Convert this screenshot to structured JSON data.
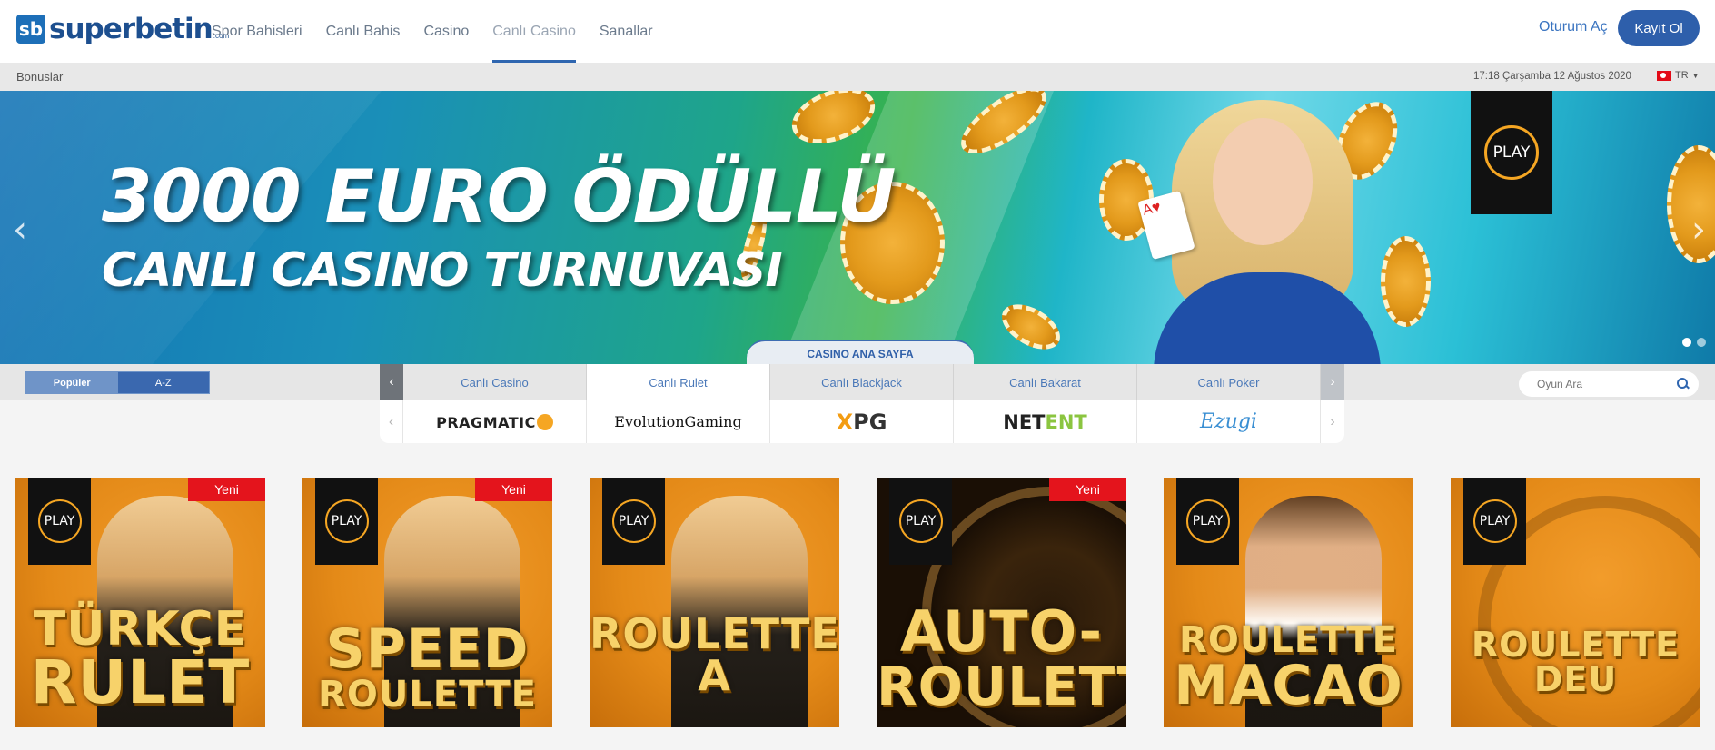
{
  "header": {
    "logo_sb": "sb",
    "logo_text": "superbetin",
    "logo_com": ".com",
    "nav": [
      "Spor Bahisleri",
      "Canlı Bahis",
      "Casino",
      "Canlı Casino",
      "Sanallar"
    ],
    "active_nav": "Canlı Casino",
    "login": "Oturum Aç",
    "register": "Kayıt Ol"
  },
  "subbar": {
    "bonuses": "Bonuslar",
    "datetime": "17:18 Çarşamba 12 Ağustos 2020",
    "language": "TR"
  },
  "banner": {
    "title_line1": "3000 EURO ÖDÜLLÜ",
    "title_line2": "CANLI CASINO TURNUVASI",
    "play_badge": "PLAY",
    "prev_arrow": "‹",
    "next_arrow": "›"
  },
  "home_tab": "CASINO ANA SAYFA",
  "filters": {
    "popular": "Popüler",
    "az": "A-Z"
  },
  "categories": [
    "Canlı Casino",
    "Canlı Rulet",
    "Canlı Blackjack",
    "Canlı Bakarat",
    "Canlı Poker"
  ],
  "active_category": "Canlı Rulet",
  "search": {
    "placeholder": "Oyun Ara"
  },
  "providers": {
    "pragmatic": "PRAGMATIC",
    "evolution": "EvolutionGaming",
    "xpg_x": "X",
    "xpg_pg": "PG",
    "netent_net": "NET",
    "netent_ent": "ENT",
    "ezugi": "Ezugi"
  },
  "games": [
    {
      "title_l1": "TÜRKÇE",
      "title_l2": "RULET",
      "badge": "Yeni",
      "play": "PLAY"
    },
    {
      "title_l1": "SPEED",
      "title_l2": "ROULETTE",
      "badge": "Yeni",
      "play": "PLAY"
    },
    {
      "title_l1": "",
      "title_l2": "ROULETTE A",
      "badge": "",
      "play": "PLAY"
    },
    {
      "title_l1": "AUTO-",
      "title_l2": "ROULETTE",
      "badge": "Yeni",
      "play": "PLAY"
    },
    {
      "title_l1": "ROULETTE",
      "title_l2": "MACAO",
      "badge": "",
      "play": "PLAY"
    },
    {
      "title_l1": "",
      "title_l2": "ROULETTE DEU",
      "badge": "",
      "play": "PLAY"
    }
  ],
  "colors": {
    "brand": "#2e5fab",
    "accent_orange": "#e48a18",
    "badge_red": "#e4141c"
  }
}
